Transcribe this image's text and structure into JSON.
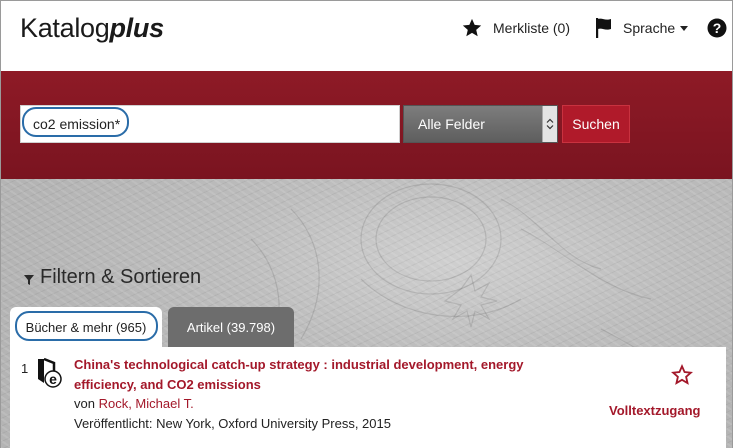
{
  "header": {
    "logo_main": "Katalog",
    "logo_plus": "plus",
    "merkliste_label": "Merkliste (0)",
    "sprache_label": "Sprache"
  },
  "search": {
    "query": "co2 emission*",
    "field_select": "Alle Felder",
    "submit_label": "Suchen"
  },
  "filter": {
    "heading": "Filtern & Sortieren"
  },
  "tabs": [
    {
      "label": "Bücher & mehr (965)",
      "active": true
    },
    {
      "label": "Artikel (39.798)",
      "active": false
    }
  ],
  "results": [
    {
      "number": "1",
      "title": "China's technological catch-up strategy : industrial development, energy efficiency, and CO2 emissions",
      "author_prefix": "von ",
      "author": "Rock, Michael T.",
      "published": "Veröffentlicht: New York, Oxford University Press, 2015",
      "fulltext_label": "Volltextzugang"
    }
  ],
  "colors": {
    "brand_red": "#8e1a26",
    "link_red": "#a3182a",
    "highlight_blue": "#2a6ca8"
  }
}
